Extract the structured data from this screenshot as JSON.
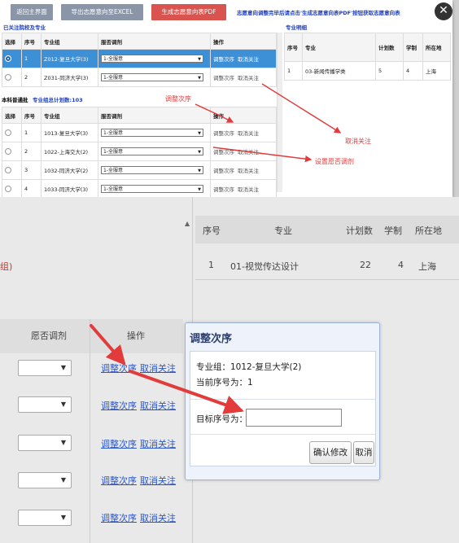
{
  "top": {
    "buttons": {
      "back": "返回主界面",
      "export": "导出志愿意向至EXCEL",
      "pdf": "生成志愿意向表PDF"
    },
    "notice": "志愿意向调整完毕后请点击'生成志愿意向表PDF'按钮获取志愿意向表",
    "followed_title": "已关注院校及专业",
    "major_detail_title": "专业明细",
    "table1": {
      "headers": [
        "选择",
        "序号",
        "专业组",
        "服否调剂",
        "操作"
      ],
      "rows": [
        {
          "idx": "1",
          "group": "Z012-复旦大学(3)",
          "adjust": "1-全服意",
          "op1": "调整次序",
          "op2": "取消关注",
          "selected": true
        },
        {
          "idx": "2",
          "group": "Z031-同济大学(3)",
          "adjust": "1-全服意",
          "op1": "调整次序",
          "op2": "取消关注",
          "selected": false
        }
      ]
    },
    "batch_label": "本科普通批",
    "batch_total": "专业组总计划数:103",
    "table2": {
      "headers": [
        "选择",
        "序号",
        "专业组",
        "服否调剂",
        "操作"
      ],
      "rows": [
        {
          "idx": "1",
          "group": "1013-复旦大学(3)",
          "adjust": "1-全服意",
          "op1": "调整次序",
          "op2": "取消关注"
        },
        {
          "idx": "2",
          "group": "1022-上海交大(2)",
          "adjust": "1-全服意",
          "op1": "调整次序",
          "op2": "取消关注"
        },
        {
          "idx": "3",
          "group": "1032-同济大学(2)",
          "adjust": "1-全服意",
          "op1": "调整次序",
          "op2": "取消关注"
        },
        {
          "idx": "4",
          "group": "1033-同济大学(3)",
          "adjust": "1-全服意",
          "op1": "调整次序",
          "op2": "取消关注"
        }
      ]
    },
    "detail_table": {
      "headers": [
        "序号",
        "专业",
        "计划数",
        "学制",
        "所在地"
      ],
      "rows": [
        {
          "idx": "1",
          "major": "03-新闻传播学类",
          "plan": "5",
          "years": "4",
          "loc": "上海"
        }
      ]
    },
    "annotations": {
      "reorder": "调整次序",
      "unfollow": "取消关注",
      "set_adjust": "设置愿否调剂"
    }
  },
  "bottom": {
    "detail_headers": [
      "序号",
      "专业",
      "计划数",
      "学制",
      "所在地"
    ],
    "detail_row": {
      "idx": "1",
      "major": "01-视觉传达设计",
      "plan": "22",
      "years": "4",
      "loc": "上海"
    },
    "group_fragment": "组)",
    "col_adjust": "愿否调剂",
    "col_op": "操作",
    "row_links": [
      {
        "op1": "调整次序",
        "op2": "取消关注"
      },
      {
        "op1": "调整次序",
        "op2": "取消关注"
      },
      {
        "op1": "调整次序",
        "op2": "取消关注"
      },
      {
        "op1": "调整次序",
        "op2": "取消关注"
      },
      {
        "op1": "调整次序",
        "op2": "取消关注"
      }
    ]
  },
  "modal": {
    "title": "调整次序",
    "group_line": "专业组：1012-复旦大学(2)",
    "current_line": "当前序号为：1",
    "target_label": "目标序号为：",
    "target_value": "",
    "confirm": "确认修改",
    "cancel": "取消"
  },
  "colors": {
    "accent": "#1f3fbf",
    "selected_row": "#3d8fd6",
    "annotation": "#e23b3b",
    "link": "#2b57c8"
  },
  "icons": {
    "close": "close-icon",
    "dropdown": "chevron-down-icon",
    "scroll": "scroll-up-icon"
  }
}
